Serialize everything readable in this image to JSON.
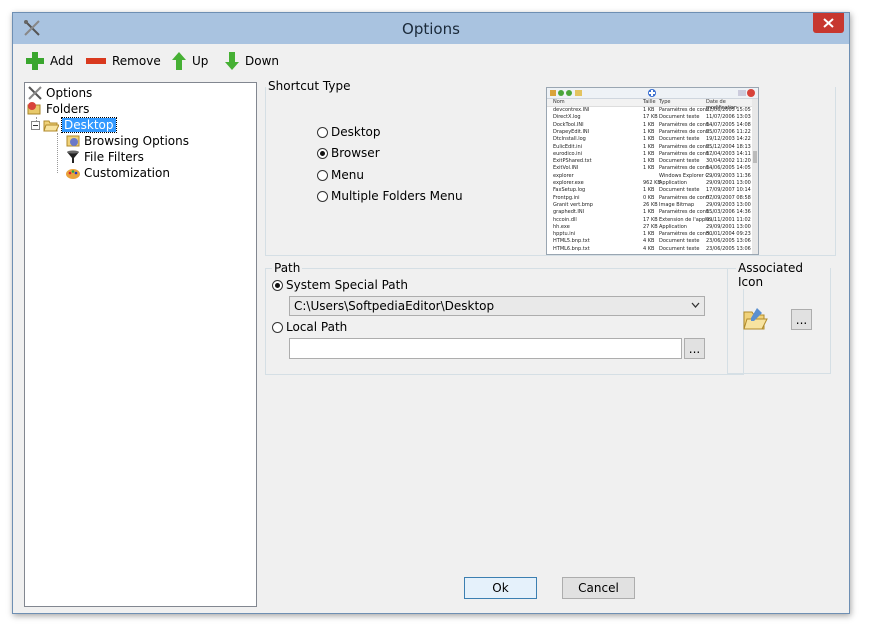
{
  "window": {
    "title": "Options"
  },
  "toolbar": {
    "add_label": "Add",
    "remove_label": "Remove",
    "up_label": "Up",
    "down_label": "Down"
  },
  "tree": {
    "root": "Options",
    "folders": "Folders",
    "desktop": "Desktop",
    "children": [
      "Browsing Options",
      "File Filters",
      "Customization"
    ]
  },
  "shortcut_type": {
    "label": "Shortcut Type",
    "options": [
      "Desktop",
      "Browser",
      "Menu",
      "Multiple Folders Menu"
    ],
    "selected": "Browser"
  },
  "preview": {
    "headers": [
      "Nom",
      "Taille",
      "Type",
      "Date de modification"
    ],
    "rows": [
      [
        "devcontrex.INI",
        "1 KB",
        "Paramètres de confi...",
        "27/06/2005 15:05"
      ],
      [
        "DirectX.log",
        "17 KB",
        "Document texte",
        "11/07/2006 13:03"
      ],
      [
        "DockTool.INI",
        "1 KB",
        "Paramètres de confi...",
        "14/07/2005 14:08"
      ],
      [
        "DrapeyEdit.INI",
        "1 KB",
        "Paramètres de confi...",
        "25/07/2006 11:22"
      ],
      [
        "DtcInstall.log",
        "1 KB",
        "Document texte",
        "19/12/2003 14:22"
      ],
      [
        "EulicEdit.ini",
        "1 KB",
        "Paramètres de confi...",
        "25/12/2004 18:13"
      ],
      [
        "eurodico.ini",
        "1 KB",
        "Paramètres de confi...",
        "17/04/2003 14:11"
      ],
      [
        "ExitPShared.txt",
        "1 KB",
        "Document texte",
        "30/04/2002 11:20"
      ],
      [
        "ExitVol.INI",
        "1 KB",
        "Paramètres de confi...",
        "14/06/2005 14:05"
      ],
      [
        "explorer",
        "",
        "Windows Explorer C...",
        "29/09/2003 11:36"
      ],
      [
        "explorer.exe",
        "962 KB",
        "Application",
        "29/09/2001 13:00"
      ],
      [
        "FaxSetup.log",
        "1 KB",
        "Document texte",
        "17/09/2007 10:14"
      ],
      [
        "Frontpg.ini",
        "0 KB",
        "Paramètres de confi...",
        "07/09/2007 08:58"
      ],
      [
        "Granit vert.bmp",
        "26 KB",
        "Image Bitmap",
        "29/09/2003 13:00"
      ],
      [
        "graphedt.INI",
        "1 KB",
        "Paramètres de confi...",
        "15/03/2006 14:36"
      ],
      [
        "hccoin.dll",
        "17 KB",
        "Extension de l'applic...",
        "09/11/2001 11:02"
      ],
      [
        "hh.exe",
        "27 KB",
        "Application",
        "29/09/2001 13:00"
      ],
      [
        "hpptu.ini",
        "1 KB",
        "Paramètres de confi...",
        "30/01/2004 09:23"
      ],
      [
        "HTML5.bnp.txt",
        "4 KB",
        "Document texte",
        "23/06/2005 13:06"
      ],
      [
        "HTML6.bnp.txt",
        "4 KB",
        "Document texte",
        "23/06/2005 13:06"
      ]
    ]
  },
  "path": {
    "label": "Path",
    "system_special_label": "System Special Path",
    "system_special_value": "C:\\Users\\SoftpediaEditor\\Desktop",
    "local_path_label": "Local Path",
    "local_path_value": "",
    "browse_label": "..."
  },
  "associated_icon": {
    "label": "Associated Icon",
    "browse_label": "..."
  },
  "footer": {
    "ok_label": "Ok",
    "cancel_label": "Cancel"
  },
  "colors": {
    "titlebar": "#a9c3e0",
    "selection": "#3399ff",
    "close": "#c7372f"
  }
}
